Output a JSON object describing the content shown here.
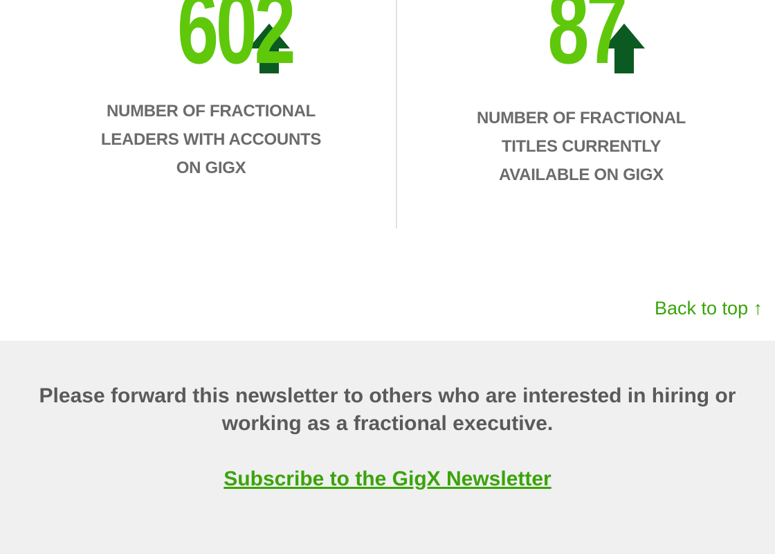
{
  "stats": {
    "left": {
      "value": "602",
      "label_lines": [
        "NUMBER OF FRACTIONAL",
        "LEADERS WITH ACCOUNTS",
        "ON GIGX"
      ]
    },
    "right": {
      "value": "87",
      "label_lines": [
        "NUMBER OF FRACTIONAL",
        "TITLES CURRENTLY",
        "AVAILABLE ON GIGX"
      ]
    },
    "icons": {
      "trend": "up-arrow-icon"
    }
  },
  "nav": {
    "back_to_top": "Back to top ↑"
  },
  "footer": {
    "forward_text": "Please forward this newsletter to others who are interested in hiring or working as a fractional executive.",
    "subscribe_link": "Subscribe to the GigX Newsletter"
  },
  "colors": {
    "number_green": "#5fc80b",
    "arrow_dark_green": "#0b5a22",
    "link_green": "#3aa40a",
    "label_gray": "#6b6b6b",
    "footer_bg": "#f0f0f0"
  }
}
